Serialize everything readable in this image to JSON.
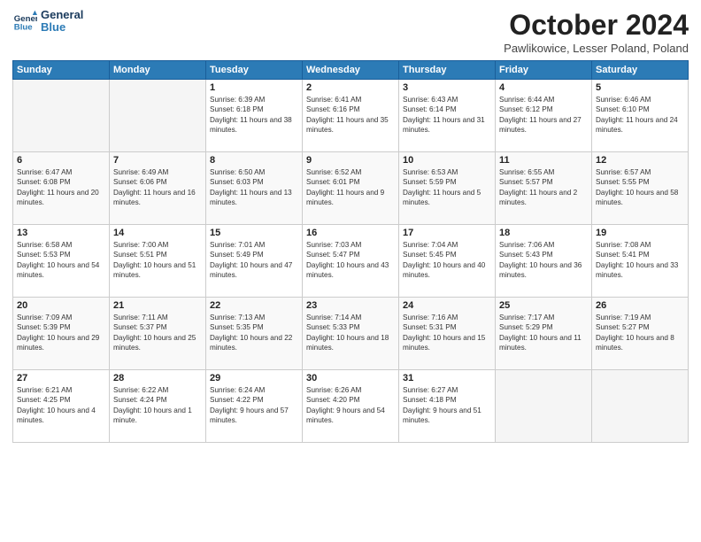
{
  "header": {
    "logo_text_line1": "General",
    "logo_text_line2": "Blue",
    "month_title": "October 2024",
    "location": "Pawlikowice, Lesser Poland, Poland"
  },
  "days_of_week": [
    "Sunday",
    "Monday",
    "Tuesday",
    "Wednesday",
    "Thursday",
    "Friday",
    "Saturday"
  ],
  "weeks": [
    [
      {
        "day": "",
        "info": ""
      },
      {
        "day": "",
        "info": ""
      },
      {
        "day": "1",
        "info": "Sunrise: 6:39 AM\nSunset: 6:18 PM\nDaylight: 11 hours and 38 minutes."
      },
      {
        "day": "2",
        "info": "Sunrise: 6:41 AM\nSunset: 6:16 PM\nDaylight: 11 hours and 35 minutes."
      },
      {
        "day": "3",
        "info": "Sunrise: 6:43 AM\nSunset: 6:14 PM\nDaylight: 11 hours and 31 minutes."
      },
      {
        "day": "4",
        "info": "Sunrise: 6:44 AM\nSunset: 6:12 PM\nDaylight: 11 hours and 27 minutes."
      },
      {
        "day": "5",
        "info": "Sunrise: 6:46 AM\nSunset: 6:10 PM\nDaylight: 11 hours and 24 minutes."
      }
    ],
    [
      {
        "day": "6",
        "info": "Sunrise: 6:47 AM\nSunset: 6:08 PM\nDaylight: 11 hours and 20 minutes."
      },
      {
        "day": "7",
        "info": "Sunrise: 6:49 AM\nSunset: 6:06 PM\nDaylight: 11 hours and 16 minutes."
      },
      {
        "day": "8",
        "info": "Sunrise: 6:50 AM\nSunset: 6:03 PM\nDaylight: 11 hours and 13 minutes."
      },
      {
        "day": "9",
        "info": "Sunrise: 6:52 AM\nSunset: 6:01 PM\nDaylight: 11 hours and 9 minutes."
      },
      {
        "day": "10",
        "info": "Sunrise: 6:53 AM\nSunset: 5:59 PM\nDaylight: 11 hours and 5 minutes."
      },
      {
        "day": "11",
        "info": "Sunrise: 6:55 AM\nSunset: 5:57 PM\nDaylight: 11 hours and 2 minutes."
      },
      {
        "day": "12",
        "info": "Sunrise: 6:57 AM\nSunset: 5:55 PM\nDaylight: 10 hours and 58 minutes."
      }
    ],
    [
      {
        "day": "13",
        "info": "Sunrise: 6:58 AM\nSunset: 5:53 PM\nDaylight: 10 hours and 54 minutes."
      },
      {
        "day": "14",
        "info": "Sunrise: 7:00 AM\nSunset: 5:51 PM\nDaylight: 10 hours and 51 minutes."
      },
      {
        "day": "15",
        "info": "Sunrise: 7:01 AM\nSunset: 5:49 PM\nDaylight: 10 hours and 47 minutes."
      },
      {
        "day": "16",
        "info": "Sunrise: 7:03 AM\nSunset: 5:47 PM\nDaylight: 10 hours and 43 minutes."
      },
      {
        "day": "17",
        "info": "Sunrise: 7:04 AM\nSunset: 5:45 PM\nDaylight: 10 hours and 40 minutes."
      },
      {
        "day": "18",
        "info": "Sunrise: 7:06 AM\nSunset: 5:43 PM\nDaylight: 10 hours and 36 minutes."
      },
      {
        "day": "19",
        "info": "Sunrise: 7:08 AM\nSunset: 5:41 PM\nDaylight: 10 hours and 33 minutes."
      }
    ],
    [
      {
        "day": "20",
        "info": "Sunrise: 7:09 AM\nSunset: 5:39 PM\nDaylight: 10 hours and 29 minutes."
      },
      {
        "day": "21",
        "info": "Sunrise: 7:11 AM\nSunset: 5:37 PM\nDaylight: 10 hours and 25 minutes."
      },
      {
        "day": "22",
        "info": "Sunrise: 7:13 AM\nSunset: 5:35 PM\nDaylight: 10 hours and 22 minutes."
      },
      {
        "day": "23",
        "info": "Sunrise: 7:14 AM\nSunset: 5:33 PM\nDaylight: 10 hours and 18 minutes."
      },
      {
        "day": "24",
        "info": "Sunrise: 7:16 AM\nSunset: 5:31 PM\nDaylight: 10 hours and 15 minutes."
      },
      {
        "day": "25",
        "info": "Sunrise: 7:17 AM\nSunset: 5:29 PM\nDaylight: 10 hours and 11 minutes."
      },
      {
        "day": "26",
        "info": "Sunrise: 7:19 AM\nSunset: 5:27 PM\nDaylight: 10 hours and 8 minutes."
      }
    ],
    [
      {
        "day": "27",
        "info": "Sunrise: 6:21 AM\nSunset: 4:25 PM\nDaylight: 10 hours and 4 minutes."
      },
      {
        "day": "28",
        "info": "Sunrise: 6:22 AM\nSunset: 4:24 PM\nDaylight: 10 hours and 1 minute."
      },
      {
        "day": "29",
        "info": "Sunrise: 6:24 AM\nSunset: 4:22 PM\nDaylight: 9 hours and 57 minutes."
      },
      {
        "day": "30",
        "info": "Sunrise: 6:26 AM\nSunset: 4:20 PM\nDaylight: 9 hours and 54 minutes."
      },
      {
        "day": "31",
        "info": "Sunrise: 6:27 AM\nSunset: 4:18 PM\nDaylight: 9 hours and 51 minutes."
      },
      {
        "day": "",
        "info": ""
      },
      {
        "day": "",
        "info": ""
      }
    ]
  ]
}
